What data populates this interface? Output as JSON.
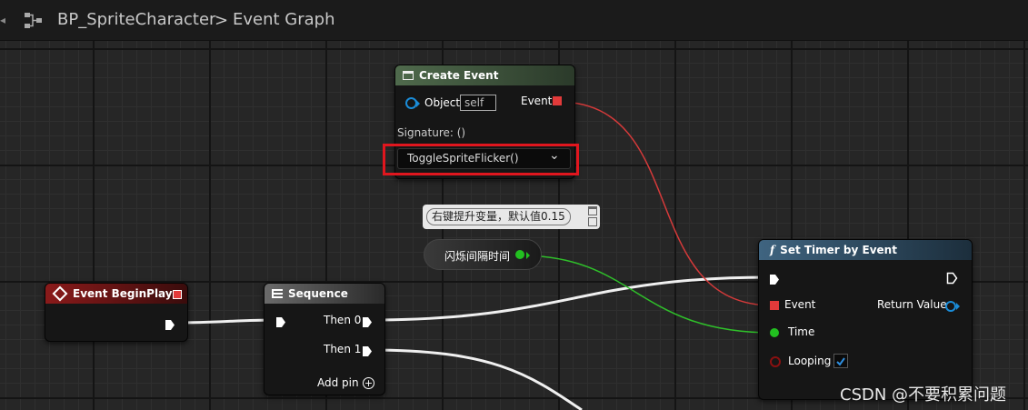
{
  "header": {
    "back_symbol": "◂",
    "blueprint_name": "BP_SpriteCharacter",
    "separator": ">",
    "graph_name": "Event Graph",
    "graph_icon": "graph-icon"
  },
  "create_event": {
    "title": "Create Event",
    "object_label": "Object",
    "object_value": "self",
    "event_label": "Event",
    "signature_label": "Signature: ()",
    "dropdown_value": "ToggleSpriteFlicker()",
    "dropdown_arrow": "⌄",
    "highlight_color": "#e0161e"
  },
  "comment": {
    "text": "右键提升变量，默认值0.15"
  },
  "variable_node": {
    "label": "闪烁间隔时间",
    "color": "#22c020"
  },
  "begin_play": {
    "title": "Event BeginPlay",
    "color": "#7a1414"
  },
  "sequence": {
    "title": "Sequence",
    "then0": "Then 0",
    "then1": "Then 1",
    "add_pin": "Add pin"
  },
  "set_timer": {
    "title": "Set Timer by Event",
    "func_symbol": "f",
    "event_label": "Event",
    "return_label": "Return Value",
    "time_label": "Time",
    "looping_label": "Looping",
    "looping_checked": true
  },
  "watermark": "CSDN @不要积累问题",
  "colors": {
    "exec_wire": "#ffffff",
    "delegate_wire": "#d63a3a",
    "float_wire": "#2fc02a",
    "object_pin": "#1a8cd8",
    "delegate_pin": "#e23a3a"
  }
}
